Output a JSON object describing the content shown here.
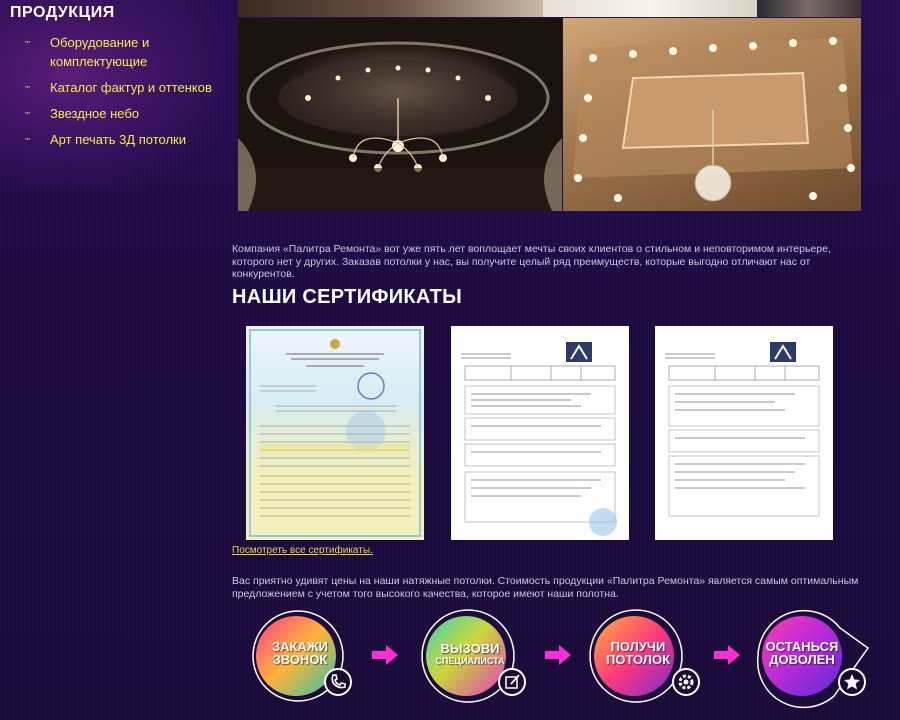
{
  "sidebar": {
    "title": "ПРОДУКЦИЯ",
    "items": [
      {
        "label": "Оборудование и комплектующие"
      },
      {
        "label": "Каталог фактур и оттенков"
      },
      {
        "label": "Звездное небо"
      },
      {
        "label": "Арт печать 3Д потолки"
      }
    ],
    "bullet": "···"
  },
  "intro_text": "Компания «Палитра Ремонта» вот уже пять лет воплощает мечты своих клиентов о стильном и неповторимом интерьере, которого нет у других. Заказав потолки у нас, вы получите целый ряд преимуществ, которые выгодно отличают нас от конкурентов.",
  "certificates": {
    "title": "НАШИ СЕРТИФИКАТЫ",
    "link_label": "Посмотреть все сертификаты."
  },
  "prices_text": "Вас приятно удивят цены на наши натяжные потолки. Стоимость продукции «Палитра Ремонта» является самым оптимальным предложением с учетом того высокого качества, которое имеют наши полотна.",
  "actions": [
    {
      "line1": "ЗАКАЖИ",
      "line2": "ЗВОНОК",
      "icon": "phone-icon"
    },
    {
      "line1": "ВЫЗОВИ",
      "line2": "СПЕЦИАЛИСТА",
      "icon": "edit-icon"
    },
    {
      "line1": "ПОЛУЧИ",
      "line2": "ПОТОЛОК",
      "icon": "gear-icon"
    },
    {
      "line1": "ОСТАНЬСЯ",
      "line2": "ДОВОЛЕН",
      "icon": "star-icon"
    }
  ],
  "colors": {
    "background": "#1d0b3e",
    "menu_link": "#f2ec4e",
    "arrow": "#ff2bd4"
  }
}
